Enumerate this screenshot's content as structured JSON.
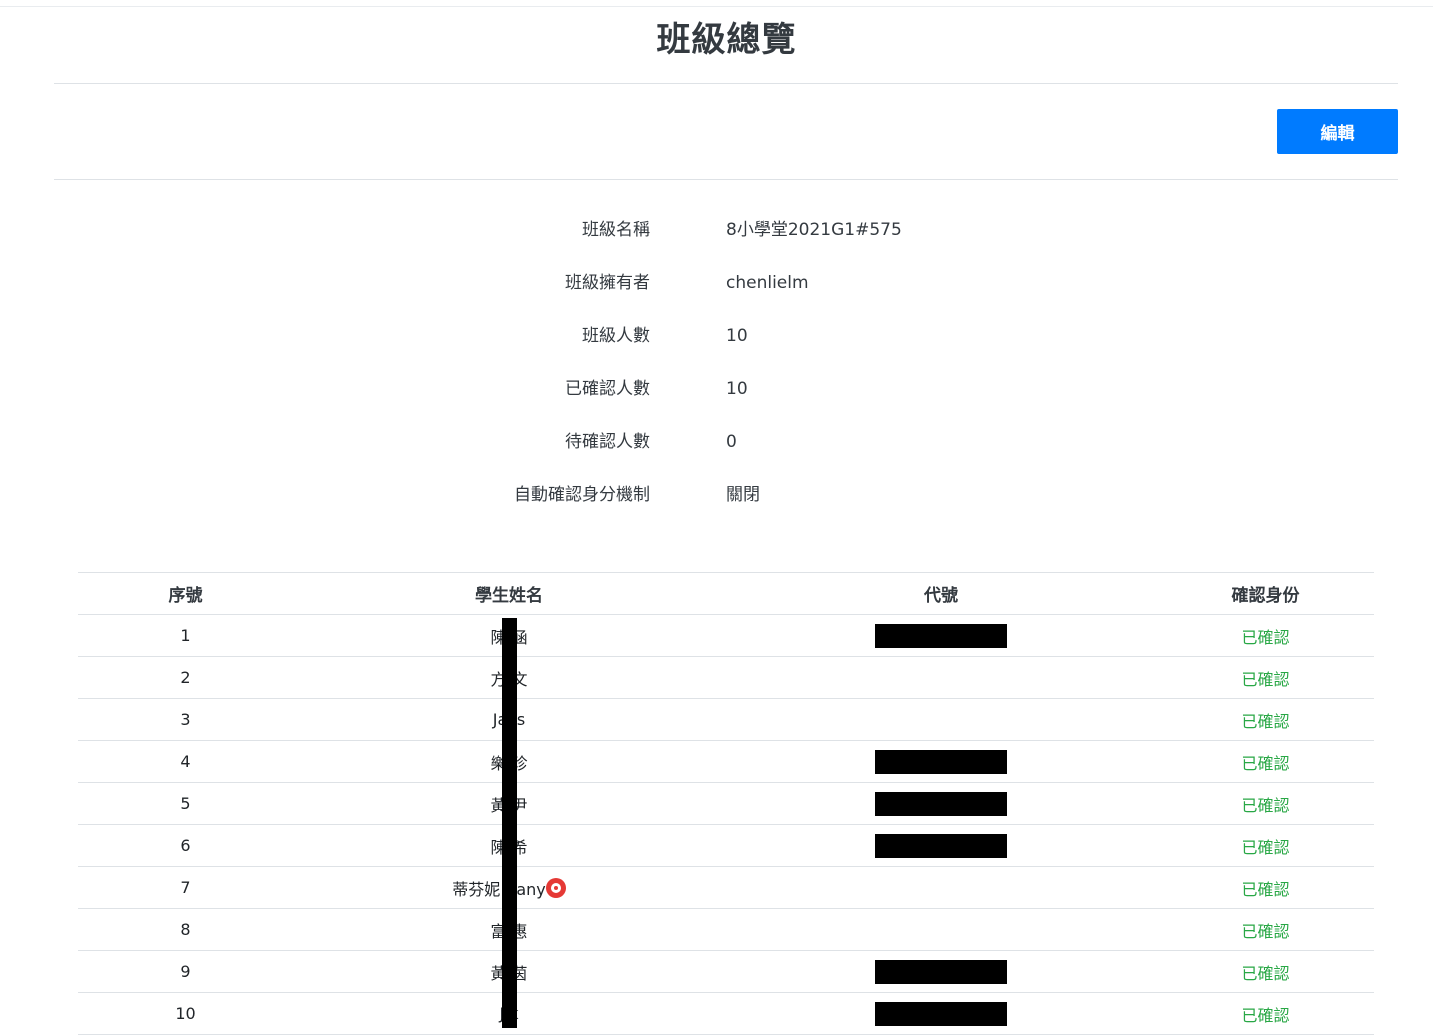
{
  "page": {
    "title": "班級總覽"
  },
  "toolbar": {
    "edit_label": "編輯"
  },
  "info": [
    {
      "label": "班級名稱",
      "value": "8小學堂2021G1#575"
    },
    {
      "label": "班級擁有者",
      "value": "chenlielm"
    },
    {
      "label": "班級人數",
      "value": "10"
    },
    {
      "label": "已確認人數",
      "value": "10"
    },
    {
      "label": "待確認人數",
      "value": "0"
    },
    {
      "label": "自動確認身分機制",
      "value": "關閉"
    }
  ],
  "table": {
    "headers": [
      "序號",
      "學生姓名",
      "代號",
      "確認身份"
    ],
    "rows": [
      {
        "index": "1",
        "name": "陳 涵",
        "code_redacted": true,
        "status": "已確認"
      },
      {
        "index": "2",
        "name": "方 文",
        "code_redacted": false,
        "status": "已確認"
      },
      {
        "index": "3",
        "name": "Ja is",
        "code_redacted": false,
        "status": "已確認"
      },
      {
        "index": "4",
        "name": "樂 珍",
        "code_redacted": true,
        "status": "已確認"
      },
      {
        "index": "5",
        "name": "黃 尹",
        "code_redacted": true,
        "status": "已確認"
      },
      {
        "index": "6",
        "name": "陳 希",
        "code_redacted": true,
        "status": "已確認"
      },
      {
        "index": "7",
        "name": "蒂芬妮 ffany",
        "code_redacted": false,
        "status": "已確認",
        "emoji": "target-emoji-icon"
      },
      {
        "index": "8",
        "name": "富 惠",
        "code_redacted": false,
        "status": "已確認"
      },
      {
        "index": "9",
        "name": "黃 茵",
        "code_redacted": true,
        "status": "已確認"
      },
      {
        "index": "10",
        "name": "J k",
        "code_redacted": true,
        "status": "已確認"
      }
    ]
  },
  "colors": {
    "primary": "#007bff",
    "confirmed": "#28a745",
    "redaction": "#000000"
  }
}
